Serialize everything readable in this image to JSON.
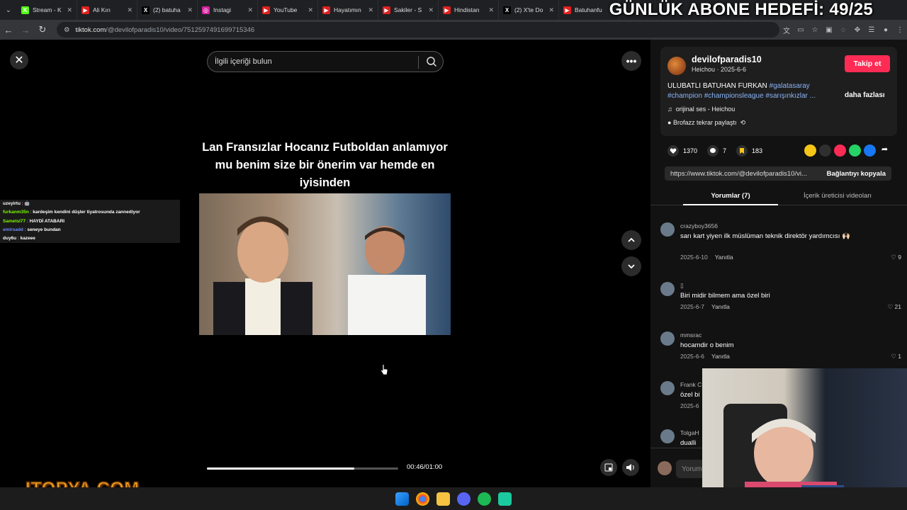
{
  "browser": {
    "tabs": [
      {
        "label": "Stream - K",
        "color": "#53fc18",
        "glyph": "K"
      },
      {
        "label": "Ali Kırı",
        "color": "#e02020",
        "glyph": "▶"
      },
      {
        "label": "(2) batuha",
        "color": "#000000",
        "glyph": "X"
      },
      {
        "label": "Instagi",
        "color": "#d6249f",
        "glyph": "◎"
      },
      {
        "label": "YouTube",
        "color": "#e02020",
        "glyph": "▶"
      },
      {
        "label": "Hayatımın",
        "color": "#e02020",
        "glyph": "▶"
      },
      {
        "label": "Sakiler - S",
        "color": "#e02020",
        "glyph": "▶"
      },
      {
        "label": "Hindistan",
        "color": "#e02020",
        "glyph": "▶"
      },
      {
        "label": "(2) X'te Do",
        "color": "#000000",
        "glyph": "X"
      },
      {
        "label": "Batuhanfu",
        "color": "#e02020",
        "glyph": "▶"
      }
    ],
    "url_host": "tiktok.com",
    "url_path": "/@devilofparadis10/video/7512597491699715346"
  },
  "stream_overlay": {
    "goal_text": "GÜNLÜK ABONE HEDEFİ: 49/25",
    "logo_text": "ITOPYA.COM"
  },
  "player": {
    "search_placeholder": "İlgili içeriği bulun",
    "caption": "Lan Fransızlar Hocanız Futboldan anlamıyor mu benim size bir önerim var hemde en iyisinden",
    "time": "00:46/01:00",
    "progress": 0.77
  },
  "chat": [
    {
      "user": "uzeyirtu",
      "msg": "🤖",
      "color": "#ffffff"
    },
    {
      "user": "furkanm35n",
      "msg": "kardeşim kendini düşler tiyatrosunda zannediyor",
      "color": "#7cfc00"
    },
    {
      "user": "Sametsl77",
      "msg": "HAYDİ ATABARI",
      "color": "#7cfc00"
    },
    {
      "user": "emirsadd",
      "msg": "seneye bundan",
      "color": "#6a8cff"
    },
    {
      "user": "duy6u",
      "msg": "kazeee",
      "color": "#ffffff"
    }
  ],
  "video_info": {
    "username": "devilofparadis10",
    "subline": "Heichou · 2025-6-6",
    "follow_label": "Takip et",
    "description_text": "ULUBATLI BATUHAN FURKAN ",
    "description_tags": "#galatasaray #champion #championsleague #sarışınkızlar ...",
    "more_label": "daha fazlası",
    "sound": "orijinal ses - Heichou",
    "repost": "Brofazz tekrar paylaştı",
    "likes": "1370",
    "comments": "7",
    "saves": "183",
    "link_url": "https://www.tiktok.com/@devilofparadis10/vi...",
    "copy_label": "Bağlantıyı kopyala"
  },
  "tabs": {
    "comments_tab": "Yorumlar (7)",
    "creator_tab": "İçerik üreticisi videoları"
  },
  "comments": [
    {
      "name": "crazyboy3656",
      "text": "sarı kart yiyen ilk müslüman teknik direktör yardımcısı 🙌🏻",
      "date": "2025-6-10",
      "reply": "Yanıtla",
      "likes": "9"
    },
    {
      "name": "▯",
      "text": "Biri midir bilmem ama özel biri",
      "date": "2025-6-7",
      "reply": "Yanıtla",
      "likes": "21"
    },
    {
      "name": "mmsrac",
      "text": "hocamdir o benim",
      "date": "2025-6-6",
      "reply": "Yanıtla",
      "likes": "1"
    },
    {
      "name": "Frank C",
      "text": "özel bi",
      "date": "2025-6",
      "reply": "",
      "likes": ""
    },
    {
      "name": "TolgaH",
      "text": "dualli",
      "date": "",
      "reply": "",
      "likes": ""
    }
  ],
  "add_comment_placeholder": "Yorum"
}
